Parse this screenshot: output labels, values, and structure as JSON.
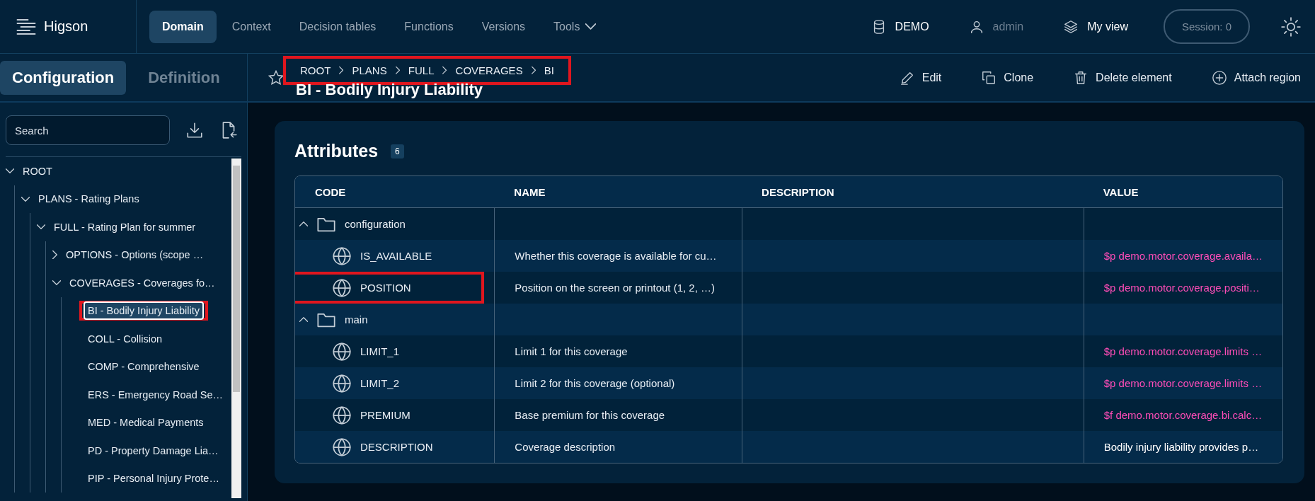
{
  "app": {
    "name": "Higson"
  },
  "nav": [
    {
      "label": "Domain",
      "selected": true,
      "has_menu": false
    },
    {
      "label": "Context",
      "selected": false,
      "has_menu": false
    },
    {
      "label": "Decision tables",
      "selected": false,
      "has_menu": false
    },
    {
      "label": "Functions",
      "selected": false,
      "has_menu": false
    },
    {
      "label": "Versions",
      "selected": false,
      "has_menu": false
    },
    {
      "label": "Tools",
      "selected": false,
      "has_menu": true
    }
  ],
  "header_items": [
    {
      "label": "DEMO",
      "disabled": false
    },
    {
      "label": "admin",
      "disabled": true
    },
    {
      "label": "My view",
      "disabled": false
    }
  ],
  "session": "Session: 0",
  "side_tabs": [
    {
      "label": "Configuration",
      "selected": true
    },
    {
      "label": "Definition",
      "selected": false
    }
  ],
  "search": {
    "placeholder": "Search"
  },
  "tree": [
    {
      "label": "ROOT",
      "expanded": true,
      "selected": false,
      "highlighted": false,
      "children": [
        {
          "label": "PLANS - Rating Plans",
          "expanded": true,
          "selected": false,
          "highlighted": false,
          "children": [
            {
              "label": "FULL - Rating Plan for summer",
              "expanded": true,
              "selected": false,
              "highlighted": false,
              "children": [
                {
                  "label": "OPTIONS - Options (scope …",
                  "expanded": false,
                  "selected": false,
                  "highlighted": false
                },
                {
                  "label": "COVERAGES - Coverages fo…",
                  "expanded": true,
                  "selected": false,
                  "highlighted": false,
                  "children": [
                    {
                      "label": "BI - Bodily Injury Liability",
                      "selected": true,
                      "highlighted": true
                    },
                    {
                      "label": "COLL - Collision",
                      "selected": false,
                      "highlighted": false
                    },
                    {
                      "label": "COMP - Comprehensive",
                      "selected": false,
                      "highlighted": false
                    },
                    {
                      "label": "ERS - Emergency Road Se…",
                      "selected": false,
                      "highlighted": false
                    },
                    {
                      "label": "MED - Medical Payments",
                      "selected": false,
                      "highlighted": false
                    },
                    {
                      "label": "PD - Property Damage Lia…",
                      "selected": false,
                      "highlighted": false
                    },
                    {
                      "label": "PIP - Personal Injury Prote…",
                      "selected": false,
                      "highlighted": false
                    }
                  ]
                }
              ]
            }
          ]
        }
      ]
    }
  ],
  "breadcrumb": {
    "items": [
      "ROOT",
      "PLANS",
      "FULL",
      "COVERAGES",
      "BI"
    ],
    "highlighted": true
  },
  "title": "BI - Bodily Injury Liability",
  "favorite": false,
  "actions": [
    "Edit",
    "Clone",
    "Delete element",
    "Attach region"
  ],
  "attributes": {
    "title": "Attributes",
    "count": "6",
    "columns": [
      "CODE",
      "NAME",
      "DESCRIPTION",
      "VALUE"
    ],
    "groups": [
      {
        "name": "configuration",
        "expanded": true,
        "rows": [
          {
            "code": "IS_AVAILABLE",
            "name": "Whether this coverage is available for cu…",
            "value": "$p demo.motor.coverage.availa…",
            "kind": "reference",
            "highlighted": false
          },
          {
            "code": "POSITION",
            "name": "Position on the screen or printout (1, 2, …)",
            "value": "$p demo.motor.coverage.positi…",
            "kind": "reference",
            "highlighted": true
          }
        ]
      },
      {
        "name": "main",
        "expanded": true,
        "rows": [
          {
            "code": "LIMIT_1",
            "name": "Limit 1 for this coverage",
            "value": "$p demo.motor.coverage.limits …",
            "kind": "reference",
            "highlighted": false
          },
          {
            "code": "LIMIT_2",
            "name": "Limit 2 for this coverage (optional)",
            "value": "$p demo.motor.coverage.limits …",
            "kind": "reference",
            "highlighted": false
          },
          {
            "code": "PREMIUM",
            "name": "Base premium for this coverage",
            "value": "$f demo.motor.coverage.bi.calc…",
            "kind": "reference",
            "highlighted": false
          },
          {
            "code": "DESCRIPTION",
            "name": "Coverage description",
            "value": "Bodily injury liability provides p…",
            "kind": "text",
            "highlighted": false
          }
        ]
      }
    ]
  }
}
